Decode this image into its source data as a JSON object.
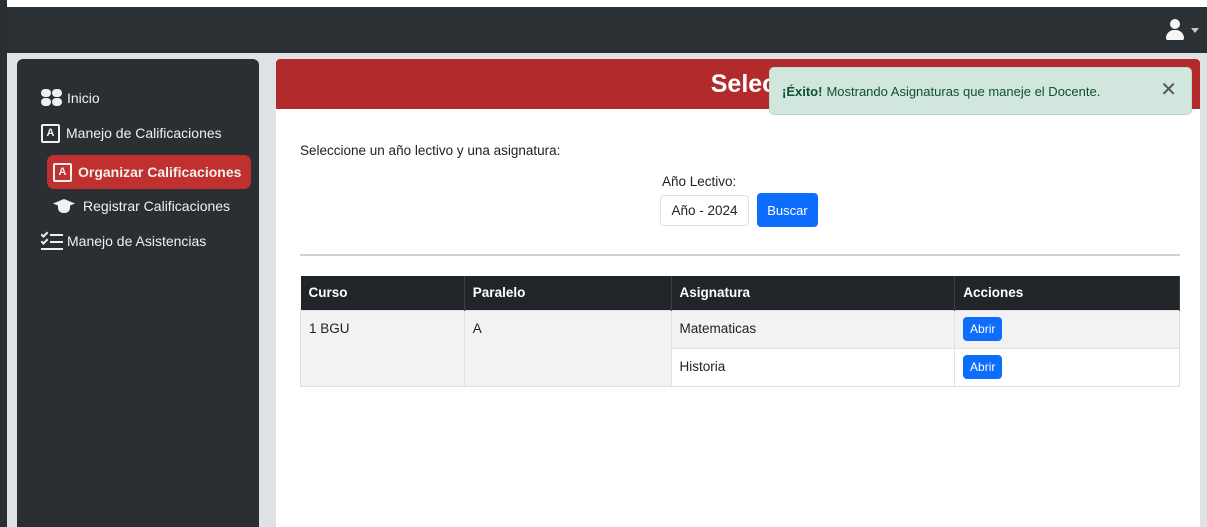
{
  "sidebar": {
    "items": [
      {
        "label": "Inicio",
        "icon": "home-grid-icon"
      },
      {
        "label": "Manejo de Calificaciones",
        "icon": "book-icon"
      },
      {
        "label": "Organizar Calificaciones",
        "icon": "book-icon",
        "active": true
      },
      {
        "label": "Registrar Calificaciones",
        "icon": "graduation-cap-icon"
      },
      {
        "label": "Manejo de Asistencias",
        "icon": "checklist-icon"
      }
    ]
  },
  "main": {
    "title": "Seleccionar Una",
    "instructions": "Seleccione un año lectivo y una asignatura:",
    "year_label": "Año Lectivo:",
    "year_value": "Año - 2024",
    "search_label": "Buscar"
  },
  "table": {
    "headers": [
      "Curso",
      "Paralelo",
      "Asignatura",
      "Acciones"
    ],
    "curso": "1 BGU",
    "paralelo": "A",
    "rows": [
      {
        "asignatura": "Matematicas",
        "accion": "Abrir"
      },
      {
        "asignatura": "Historia",
        "accion": "Abrir"
      }
    ]
  },
  "toast": {
    "strong": "¡Éxito!",
    "message": "Mostrando Asignaturas que maneje el Docente.",
    "close": "✕"
  },
  "colors": {
    "accent_red": "#b22a2a",
    "primary_blue": "#0d6efd",
    "success_bg": "#d1e7dd"
  }
}
